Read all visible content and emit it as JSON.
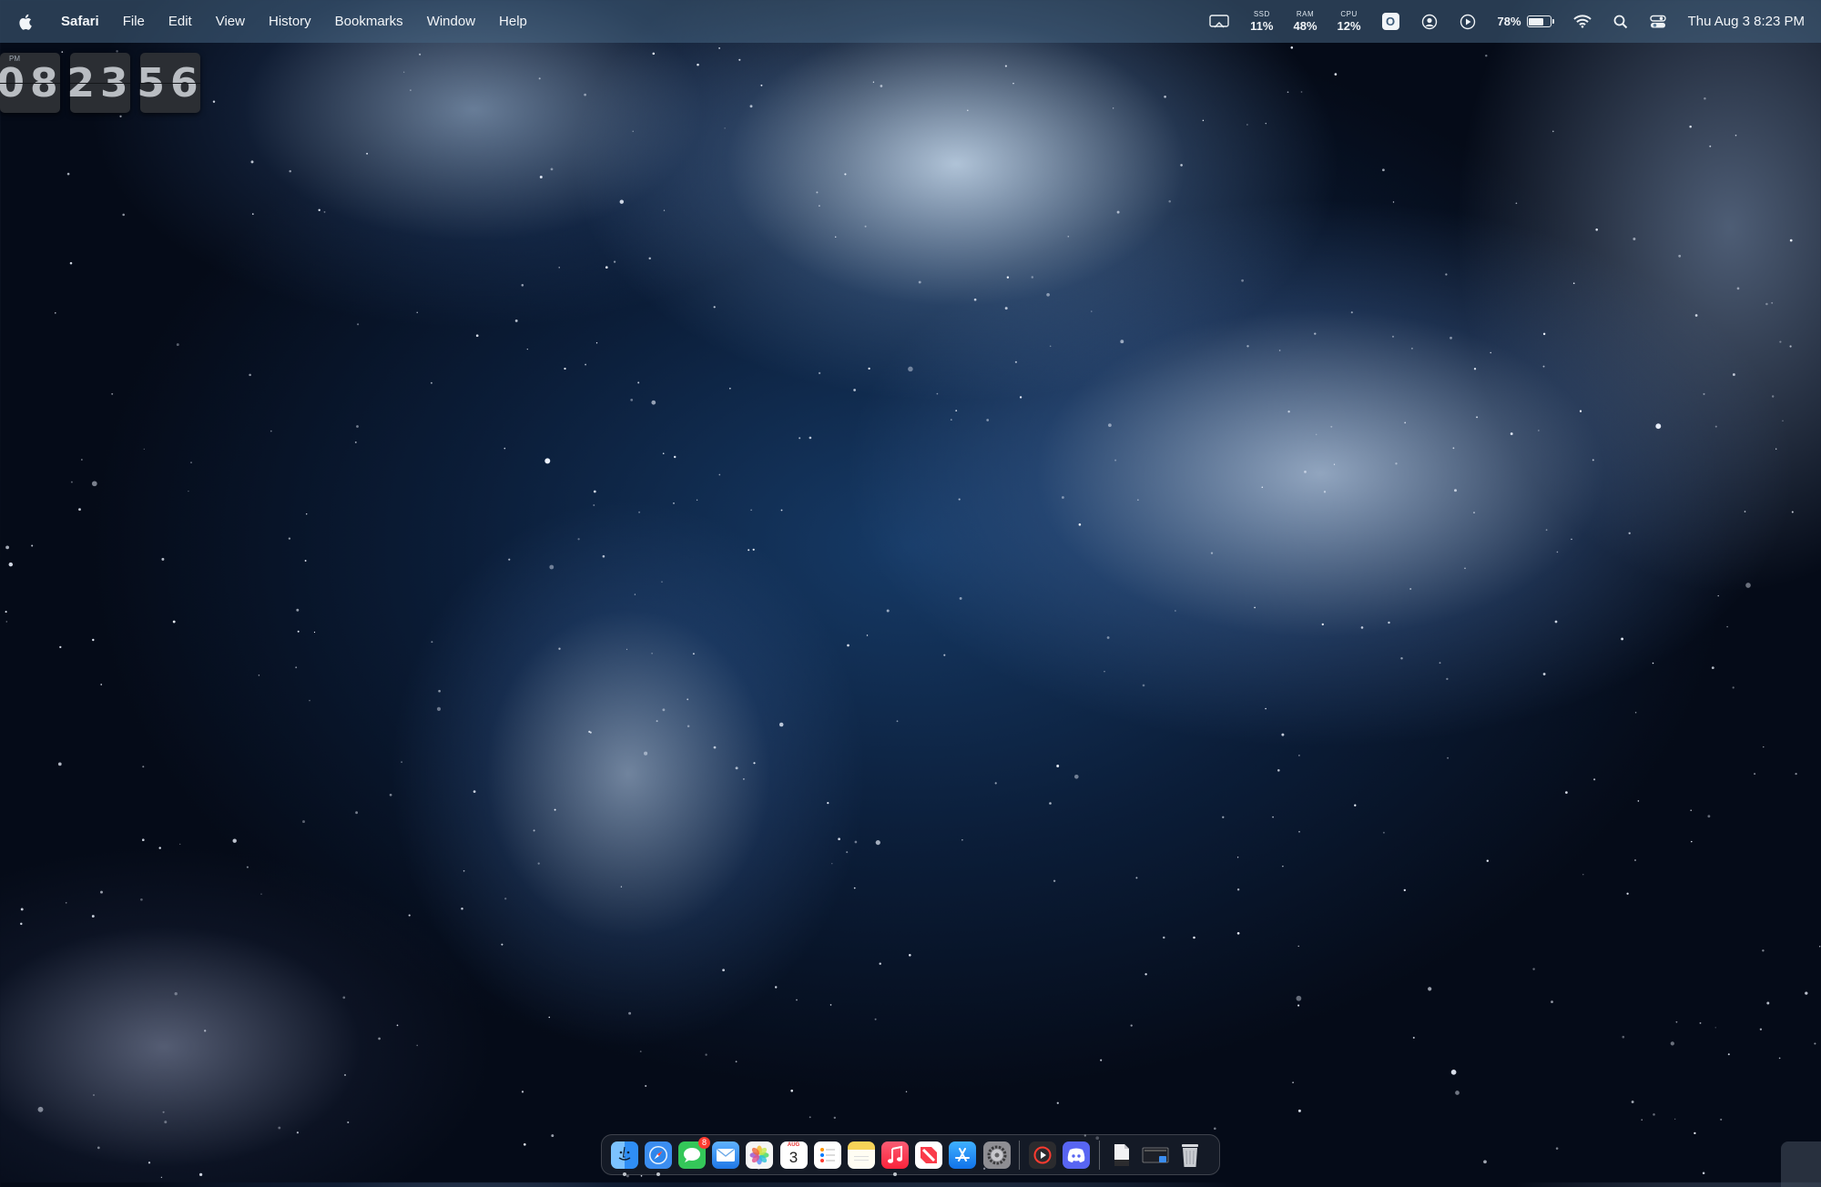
{
  "menubar": {
    "apple_icon": "apple-logo-icon",
    "app_name": "Safari",
    "menus": [
      "File",
      "Edit",
      "View",
      "History",
      "Bookmarks",
      "Window",
      "Help"
    ],
    "status": {
      "ssd": {
        "label": "SSD",
        "value": "11%"
      },
      "ram": {
        "label": "RAM",
        "value": "48%"
      },
      "cpu": {
        "label": "CPU",
        "value": "12%"
      },
      "badge_letter": "O",
      "battery_percent": "78%",
      "battery_level": 0.78,
      "datetime": "Thu Aug 3  8:23 PM"
    }
  },
  "flip_clock": {
    "ampm": "PM",
    "hours": "08",
    "minutes": "23",
    "seconds": "56"
  },
  "dock": {
    "calendar": {
      "month": "AUG",
      "day": "3"
    },
    "messages_badge": "8",
    "items": [
      {
        "name": "Finder",
        "icon": "finder-icon",
        "color": "#2f8ef5",
        "running": true
      },
      {
        "name": "Safari",
        "icon": "safari-icon",
        "color": "#3b8df0",
        "running": true
      },
      {
        "name": "Messages",
        "icon": "messages-icon",
        "color": "#34c759",
        "running": false
      },
      {
        "name": "Mail",
        "icon": "mail-icon",
        "color": "#2a86f0",
        "running": false
      },
      {
        "name": "Photos",
        "icon": "photos-icon",
        "color": "#f5f5f5",
        "running": false
      },
      {
        "name": "Calendar",
        "icon": "calendar-icon",
        "color": "#ffffff",
        "running": false
      },
      {
        "name": "Reminders",
        "icon": "reminders-icon",
        "color": "#ffffff",
        "running": false
      },
      {
        "name": "Notes",
        "icon": "notes-icon",
        "color": "#f7d358",
        "running": false
      },
      {
        "name": "Music",
        "icon": "music-icon",
        "color": "#fa3b55",
        "running": true
      },
      {
        "name": "News",
        "icon": "news-icon",
        "color": "#fa3b4a",
        "running": false
      },
      {
        "name": "App Store",
        "icon": "app-store-icon",
        "color": "#1a8cf5",
        "running": false
      },
      {
        "name": "System Settings",
        "icon": "settings-gear-icon",
        "color": "#8e8e93",
        "running": false
      },
      {
        "name": "Screen Recorder",
        "icon": "record-play-icon",
        "color": "#2b2b2e",
        "running": false
      },
      {
        "name": "Discord",
        "icon": "discord-icon",
        "color": "#5865f2",
        "running": false
      },
      {
        "name": "Document",
        "icon": "document-icon",
        "color": "#e8e8ea",
        "running": false
      },
      {
        "name": "Screenshot",
        "icon": "screenshot-thumbnail-icon",
        "color": "#3a3d44",
        "running": false
      },
      {
        "name": "Trash",
        "icon": "trash-icon",
        "color": "#c9ccd1",
        "running": false
      }
    ]
  }
}
